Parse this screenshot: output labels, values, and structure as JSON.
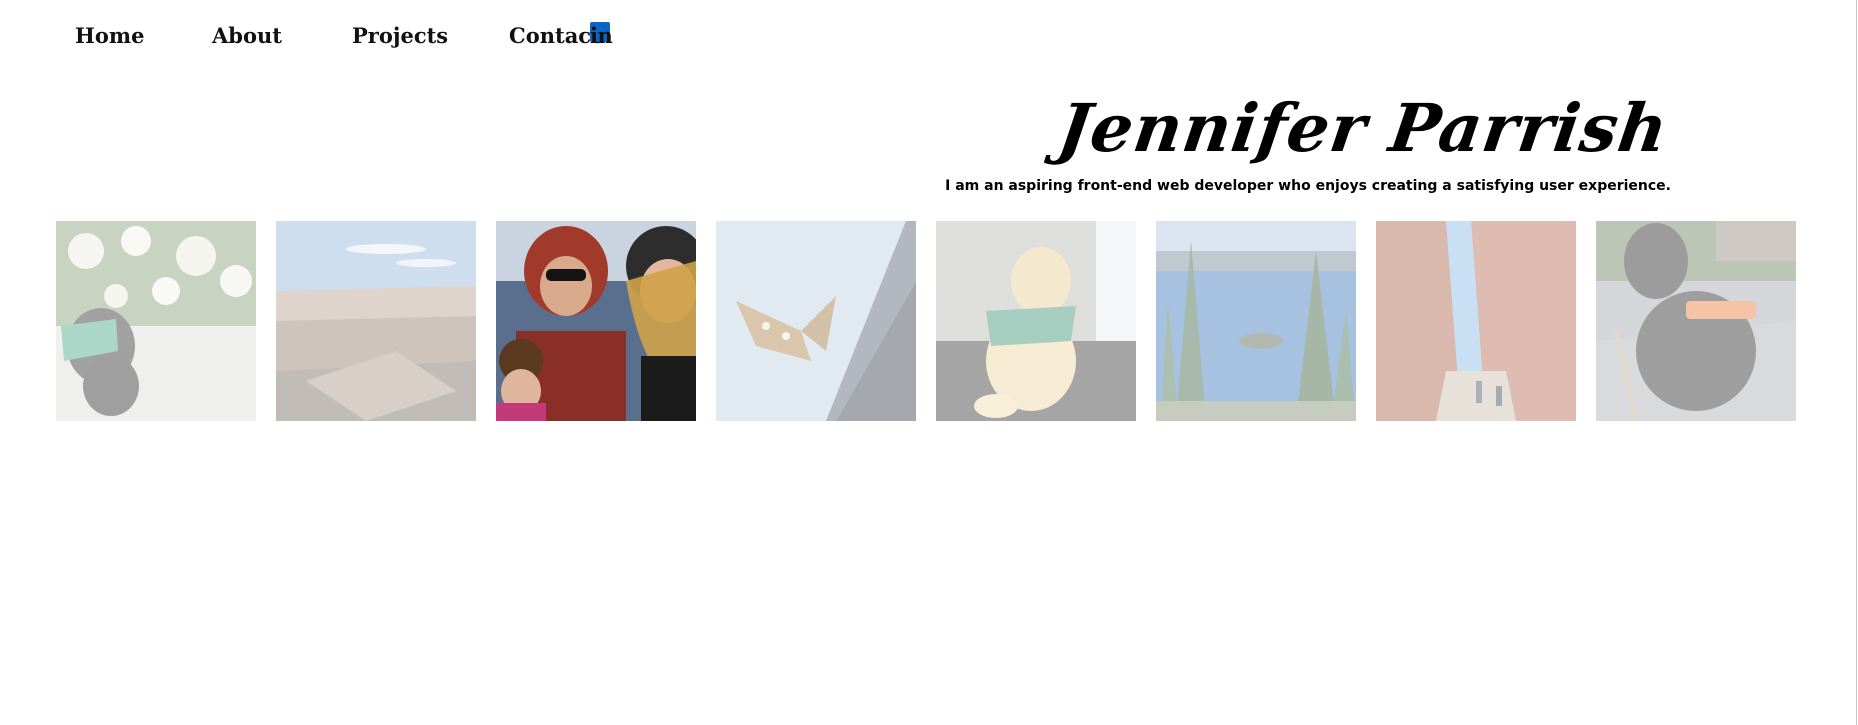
{
  "nav": {
    "home": "Home",
    "about": "About",
    "projects": "Projects",
    "contact": "Contact",
    "linkedin_icon": "linkedin-icon",
    "linkedin_glyph": "in"
  },
  "header": {
    "name": "Jennifer Parrish",
    "tagline": "I am an aspiring front-end web developer who enjoys creating a satisfying user experience."
  },
  "gallery": {
    "photos": [
      {
        "subject": "black-puppy-photo",
        "faded": true
      },
      {
        "subject": "canyon-photo",
        "faded": true
      },
      {
        "subject": "family-selfie-photo",
        "faded": false
      },
      {
        "subject": "butterfly-photo",
        "faded": true
      },
      {
        "subject": "yellow-puppy-photo",
        "faded": true
      },
      {
        "subject": "crater-lake-photo",
        "faded": true
      },
      {
        "subject": "slot-canyon-photo",
        "faded": true
      },
      {
        "subject": "black-lab-photo",
        "faded": true
      }
    ]
  },
  "colors": {
    "text": "#111111",
    "linkedin": "#0a66c2",
    "background": "#ffffff"
  }
}
